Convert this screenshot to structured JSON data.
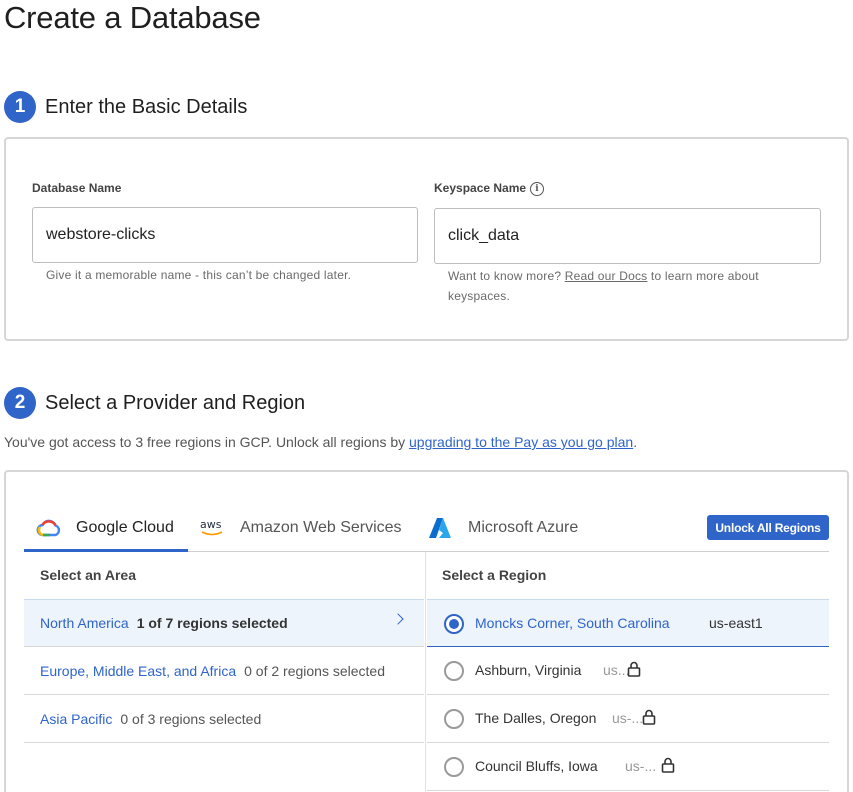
{
  "page": {
    "title": "Create a Database"
  },
  "step1": {
    "number": "1",
    "title": "Enter the Basic Details",
    "db_name": {
      "label": "Database Name",
      "value": "webstore-clicks",
      "helper": "Give it a memorable name - this can’t be changed later."
    },
    "keyspace": {
      "label": "Keyspace Name",
      "value": "click_data",
      "helper_before": "Want to know more? ",
      "helper_link": "Read our Docs",
      "helper_after": " to learn more about keyspaces."
    }
  },
  "step2": {
    "number": "2",
    "title": "Select a Provider and Region",
    "access_before": "You've got access to 3 free regions in GCP. Unlock all regions by ",
    "access_link": "upgrading to the Pay as you go plan",
    "access_after": ".",
    "tabs": [
      {
        "label": "Google Cloud",
        "icon": "google-cloud-icon",
        "active": true
      },
      {
        "label": "Amazon Web Services",
        "icon": "aws-icon",
        "active": false
      },
      {
        "label": "Microsoft Azure",
        "icon": "azure-icon",
        "active": false
      }
    ],
    "unlock_button": "Unlock All Regions",
    "area_header": "Select an Area",
    "region_header": "Select a Region",
    "areas": [
      {
        "name": "North America",
        "count": "1 of 7 regions selected",
        "selected": true
      },
      {
        "name": "Europe, Middle East, and Africa",
        "count": "0 of 2 regions selected",
        "selected": false
      },
      {
        "name": "Asia Pacific",
        "count": "0 of 3 regions selected",
        "selected": false
      }
    ],
    "regions": [
      {
        "name": "Moncks Corner, South Carolina",
        "code": "us-east1",
        "selected": true,
        "locked": false
      },
      {
        "name": "Ashburn, Virginia",
        "code": "us...",
        "selected": false,
        "locked": true
      },
      {
        "name": "The Dalles, Oregon",
        "code": "us-...",
        "selected": false,
        "locked": true
      },
      {
        "name": "Council Bluffs, Iowa",
        "code": "us-...",
        "selected": false,
        "locked": true
      }
    ]
  },
  "colors": {
    "accent": "#2f64c9",
    "selected_bg": "#eef4fb"
  }
}
